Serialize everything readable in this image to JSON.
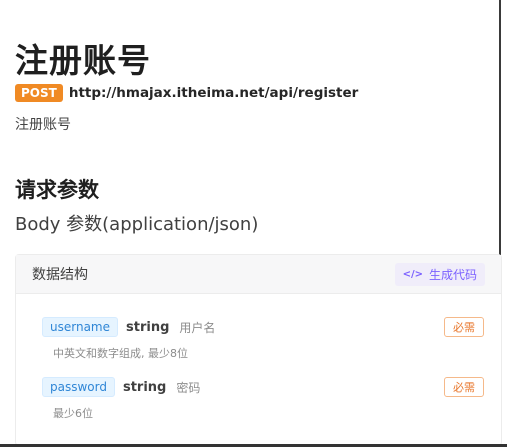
{
  "page": {
    "title": "注册账号"
  },
  "endpoint": {
    "method": "POST",
    "url": "http://hmajax.itheima.net/api/register",
    "description": "注册账号"
  },
  "request": {
    "section_title": "请求参数",
    "body_title": "Body 参数(application/json)"
  },
  "schema": {
    "label": "数据结构",
    "generate_code_label": "生成代码",
    "generate_code_icon": "code-icon",
    "fields": [
      {
        "name": "username",
        "type": "string",
        "title": "用户名",
        "description": "中英文和数字组成, 最少8位",
        "required_label": "必需"
      },
      {
        "name": "password",
        "type": "string",
        "title": "密码",
        "description": "最少6位",
        "required_label": "必需"
      }
    ]
  },
  "colors": {
    "method_badge": "#f08a24",
    "field_name_bg": "#e6f4ff",
    "required": "#e8772c",
    "generate_code": "#7b61ff"
  }
}
